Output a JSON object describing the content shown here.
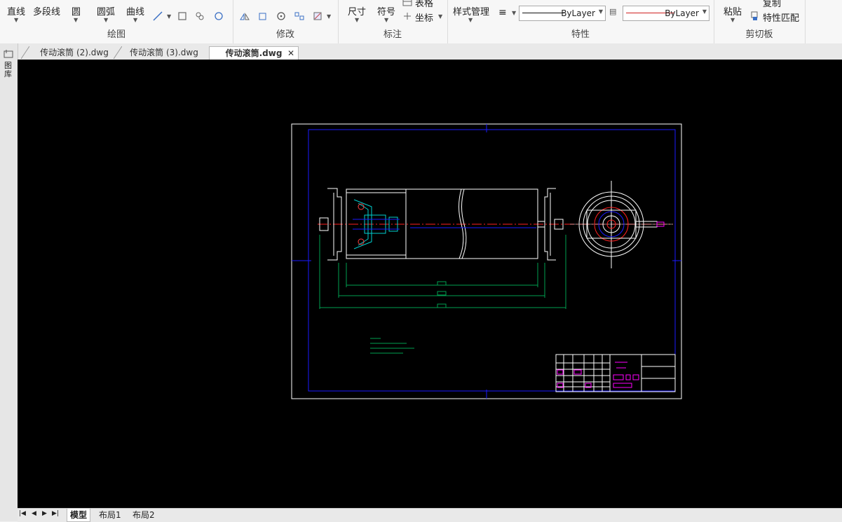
{
  "ribbon": {
    "draw": {
      "title": "绘图",
      "line": "直线",
      "polyline": "多段线",
      "circle": "圆",
      "arc": "圆弧",
      "curve": "曲线"
    },
    "modify": {
      "title": "修改"
    },
    "annotation": {
      "title": "标注",
      "dimension": "尺寸",
      "symbol": "符号",
      "table": "表格",
      "coordinate": "坐标"
    },
    "properties": {
      "title": "特性",
      "style_manager": "样式管理",
      "linetype": "ByLayer",
      "color": "ByLayer"
    },
    "clipboard": {
      "title": "剪切板",
      "paste": "粘贴",
      "copy": "复制",
      "match": "特性匹配"
    }
  },
  "tabs": [
    "传动滚筒 (2).dwg",
    "传动滚筒 (3).dwg",
    "传动滚筒.dwg"
  ],
  "side_panel_label": "图库",
  "layout_tabs": [
    "模型",
    "布局1",
    "布局2"
  ],
  "colors": {
    "canvas": "#000000",
    "frame": "#0000ff",
    "border": "#ffffff",
    "center_line": "#ff0000",
    "dimension": "#00a050",
    "block": "#ff00ff"
  }
}
